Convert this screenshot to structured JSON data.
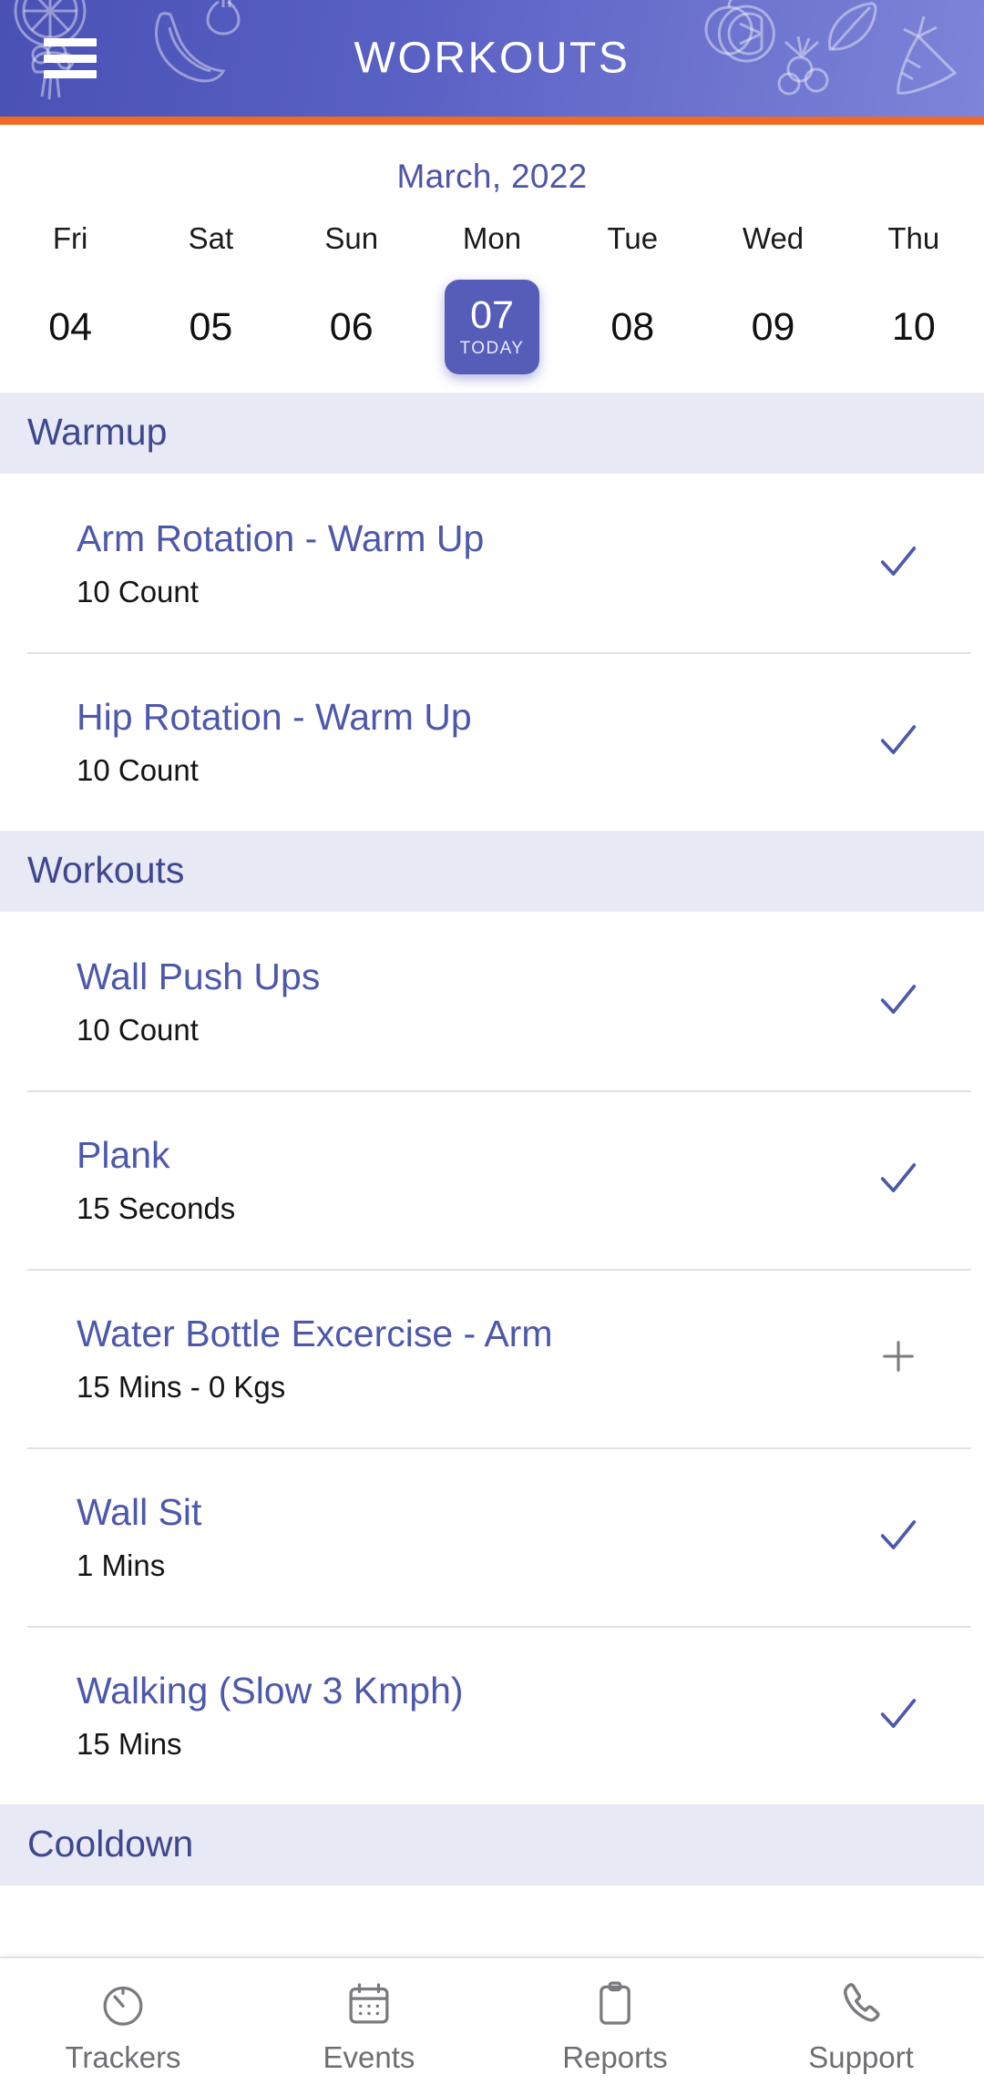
{
  "header": {
    "title": "WORKOUTS",
    "menu_icon": "hamburger-menu-icon",
    "accent_color": "#f26a21",
    "background_color": "#5a61c4"
  },
  "calendar": {
    "month_label": "March, 2022",
    "today_badge": "TODAY",
    "days": [
      {
        "dow": "Fri",
        "date": "04",
        "today": false
      },
      {
        "dow": "Sat",
        "date": "05",
        "today": false
      },
      {
        "dow": "Sun",
        "date": "06",
        "today": false
      },
      {
        "dow": "Mon",
        "date": "07",
        "today": true
      },
      {
        "dow": "Tue",
        "date": "08",
        "today": false
      },
      {
        "dow": "Wed",
        "date": "09",
        "today": false
      },
      {
        "dow": "Thu",
        "date": "10",
        "today": false
      }
    ]
  },
  "sections": [
    {
      "title": "Warmup",
      "exercises": [
        {
          "name": "Arm Rotation - Warm Up",
          "detail": "10 Count",
          "status": "check-icon"
        },
        {
          "name": "Hip Rotation - Warm Up",
          "detail": "10 Count",
          "status": "check-icon"
        }
      ]
    },
    {
      "title": "Workouts",
      "exercises": [
        {
          "name": "Wall Push Ups",
          "detail": "10 Count",
          "status": "check-icon"
        },
        {
          "name": "Plank",
          "detail": "15 Seconds",
          "status": "check-icon"
        },
        {
          "name": "Water Bottle Excercise - Arm",
          "detail": "15 Mins - 0 Kgs",
          "status": "plus-icon"
        },
        {
          "name": "Wall Sit",
          "detail": "1 Mins",
          "status": "check-icon"
        },
        {
          "name": "Walking (Slow 3 Kmph)",
          "detail": "15 Mins",
          "status": "check-icon"
        }
      ]
    },
    {
      "title": "Cooldown",
      "exercises": []
    }
  ],
  "bottom_nav": [
    {
      "label": "Trackers",
      "icon": "stopwatch-icon"
    },
    {
      "label": "Events",
      "icon": "calendar-icon"
    },
    {
      "label": "Reports",
      "icon": "clipboard-icon"
    },
    {
      "label": "Support",
      "icon": "phone-icon"
    }
  ],
  "colors": {
    "primary": "#4d58ab",
    "section_bg": "#e7e9f5",
    "accent": "#f26a21",
    "today_bg": "#565db9"
  }
}
